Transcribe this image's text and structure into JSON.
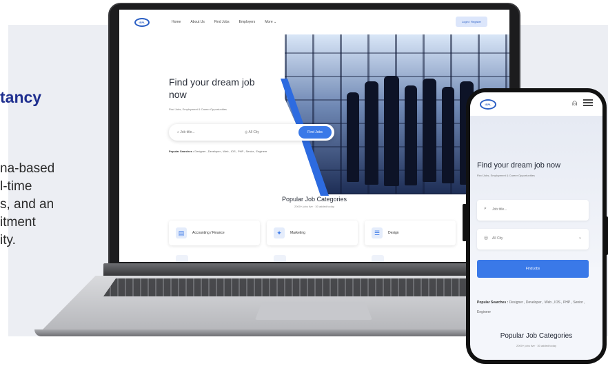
{
  "side_text": {
    "heading": "tancy",
    "lines": [
      "na-based",
      "l-time",
      "s, and an",
      "itment",
      "ity."
    ]
  },
  "laptop_site": {
    "logo": "ISPL",
    "nav": [
      "Home",
      "About Us",
      "Find Jobs",
      "Employers",
      "More ⌄"
    ],
    "login": "Login / Register",
    "hero_title_1": "Find your dream job",
    "hero_title_2": "now",
    "hero_subtitle": "Find Jobs, Employment & Career Opportunities",
    "search_placeholder": "Job title...",
    "location_value": "All City",
    "find_button": "Find Jobs",
    "popular_label": "Popular Searches :",
    "popular_terms": "Designer , Developer , Web , IOS , PHP , Senior , Engineer",
    "categories_title": "Popular Job Categories",
    "categories_subtitle": "2000+ jobs live · 30 added today",
    "categories": [
      {
        "label": "Accounting / Finance",
        "icon": "finance-icon"
      },
      {
        "label": "Marketing",
        "icon": "megaphone-icon"
      },
      {
        "label": "Design",
        "icon": "design-icon"
      }
    ]
  },
  "phone_site": {
    "logo": "ISPL",
    "hero_title": "Find your dream job now",
    "hero_subtitle": "Find Jobs, Employment & Career Opportunities",
    "search_placeholder": "Job title...",
    "location_value": "All City",
    "find_button": "Find jobs",
    "popular_label": "Popular Searches :",
    "popular_terms": "Designer , Developer , Web , IOS , PHP , Senior , Engineer",
    "categories_title": "Popular Job Categories",
    "categories_subtitle": "2000+ jobs live · 30 added today"
  },
  "colors": {
    "brand_blue": "#3a79e8",
    "heading_navy": "#1f2f8f",
    "panel_bg": "#eceef3"
  }
}
